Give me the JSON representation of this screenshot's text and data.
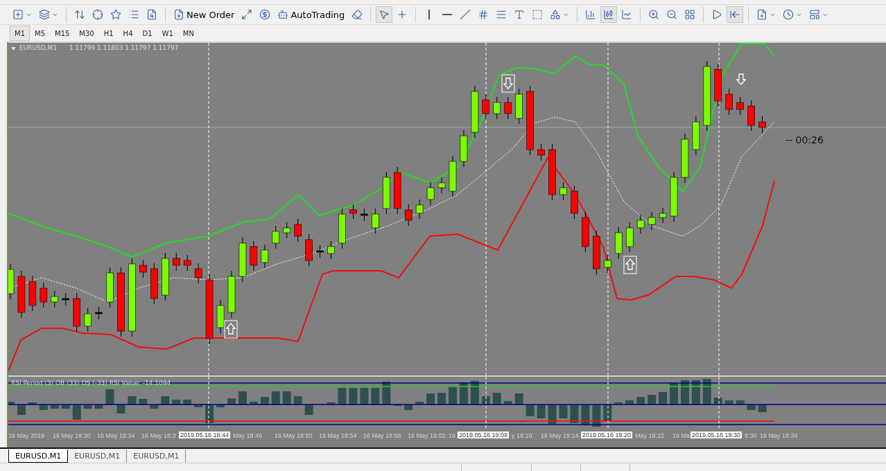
{
  "toolbar": {
    "new_order_button": {
      "label": "New Order"
    },
    "autotrading_button": {
      "label": "AutoTrading"
    },
    "cursor_tool": {
      "pressed": true
    },
    "crosshair_tool": {
      "pressed": false
    },
    "bar_chart_tool": {
      "pressed": false
    },
    "candlestick_tool": {
      "pressed": true
    },
    "line_chart_tool": {
      "pressed": false
    },
    "chart_shift_tool": {
      "pressed": false
    },
    "autoscroll_tool": {
      "pressed": true
    }
  },
  "timeframes": [
    {
      "label": "M1",
      "selected": true
    },
    {
      "label": "M5",
      "selected": false
    },
    {
      "label": "M15",
      "selected": false
    },
    {
      "label": "M30",
      "selected": false
    },
    {
      "label": "H1",
      "selected": false
    },
    {
      "label": "H4",
      "selected": false
    },
    {
      "label": "D1",
      "selected": false
    },
    {
      "label": "W1",
      "selected": false
    },
    {
      "label": "MN",
      "selected": false
    }
  ],
  "chart": {
    "symbol": "EURUSD,M1",
    "quotes": "1.11799 1.11803 1.11797 1.11797",
    "countdown": "-- 00:26",
    "indicator_label": "RSI Period (3) OB (33) OS (-33) RSI Value: -14.1094",
    "time_axis": [
      "16 May 2019",
      "16 May 18:30",
      "16 May 18:34",
      "16 May 18:3",
      "May 18:46",
      "16 May 18:50",
      "16 May 18:54",
      "16 May 18:58",
      "16 May 19:02",
      "16",
      "y 19:10",
      "16 May 19:14",
      "May 19:22",
      "16 Ma",
      "9:30",
      "16 May 19:34"
    ],
    "time_markers": [
      "2019.05.16 18:44",
      "2019.05.16 19:09",
      "2019.05.16 19:20",
      "2019.05.16 19:30"
    ]
  },
  "tabs": [
    {
      "label": "EURUSD,M1",
      "selected": true
    },
    {
      "label": "EURUSD,M1",
      "selected": false
    },
    {
      "label": "EURUSD,M1",
      "selected": false
    }
  ]
}
